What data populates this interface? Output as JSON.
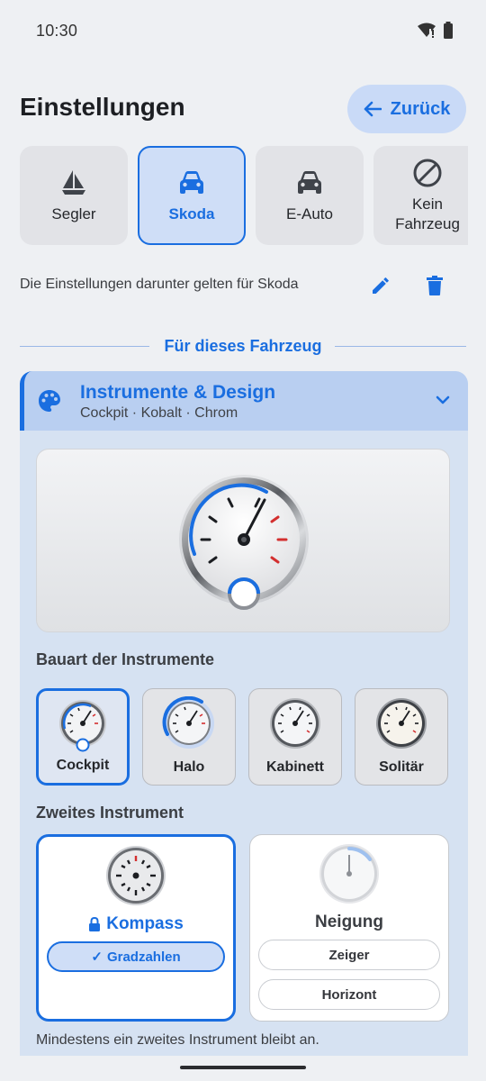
{
  "status_bar": {
    "time": "10:30"
  },
  "header": {
    "title": "Einstellungen",
    "back_label": "Zurück"
  },
  "vehicles": [
    {
      "label": "Segler",
      "icon": "sailboat-icon",
      "selected": false
    },
    {
      "label": "Skoda",
      "icon": "car-icon",
      "selected": true
    },
    {
      "label": "E-Auto",
      "icon": "car-icon",
      "selected": false
    },
    {
      "label": "Kein\nFahrzeug",
      "icon": "block-icon",
      "selected": false
    }
  ],
  "info": {
    "text": "Die Einstellungen darunter gelten für Skoda"
  },
  "section": {
    "title": "Für dieses Fahrzeug"
  },
  "panel": {
    "title": "Instrumente & Design",
    "subtitle": "Cockpit · Kobalt · Chrom",
    "style_label": "Bauart der Instrumente",
    "styles": [
      {
        "label": "Cockpit",
        "selected": true
      },
      {
        "label": "Halo",
        "selected": false
      },
      {
        "label": "Kabinett",
        "selected": false
      },
      {
        "label": "Solitär",
        "selected": false
      }
    ],
    "second_label": "Zweites Instrument",
    "compass": {
      "title": "Kompass",
      "option": "Gradzahlen",
      "locked": true
    },
    "tilt": {
      "title": "Neigung",
      "options": [
        "Zeiger",
        "Horizont"
      ]
    },
    "footnote": "Mindestens ein zweites Instrument bleibt an."
  },
  "colors": {
    "accent": "#1a6ee0",
    "danger": "#d32f2f",
    "panel_bg": "#d6e2f2"
  }
}
